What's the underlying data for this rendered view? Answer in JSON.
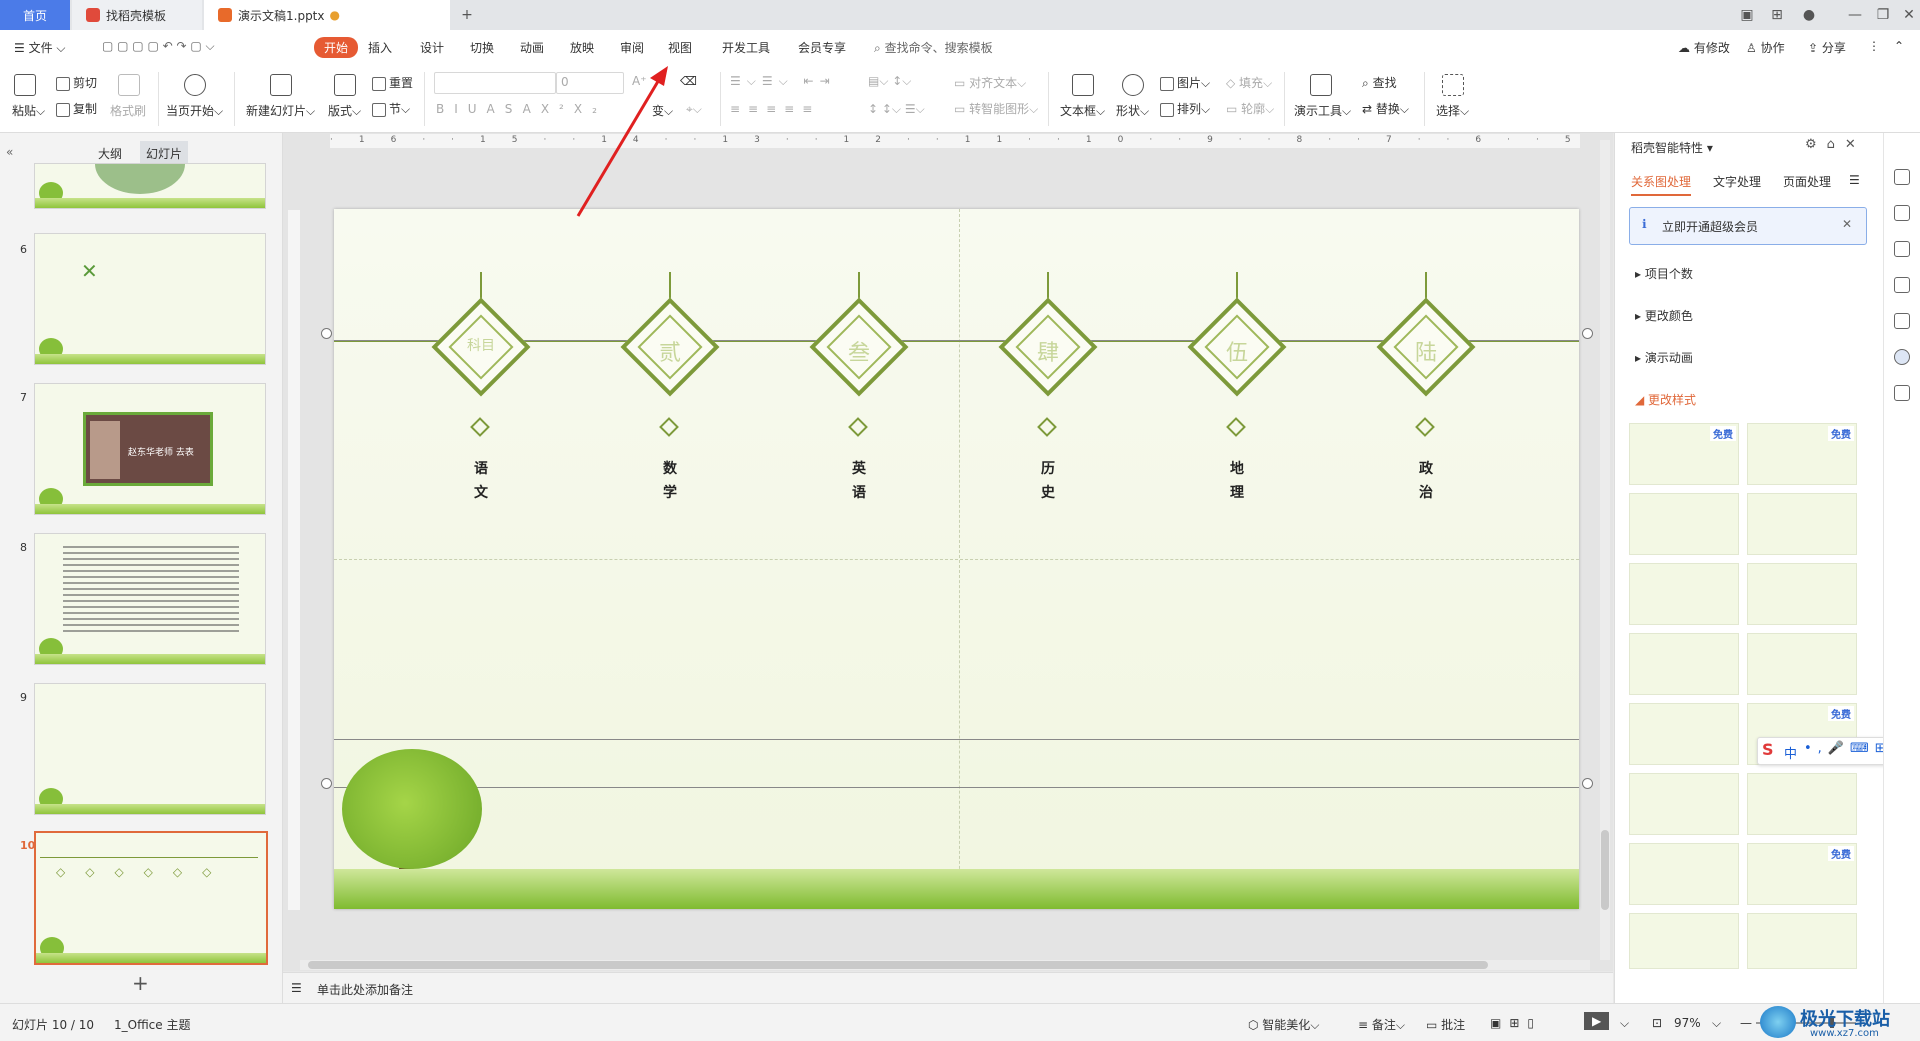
{
  "titlebar": {
    "tabs": [
      {
        "label": "首页"
      },
      {
        "label": "找稻壳模板"
      },
      {
        "label": "演示文稿1.pptx"
      }
    ],
    "new_tab_label": "+"
  },
  "menubar": {
    "file": "文件",
    "items": [
      "开始",
      "插入",
      "设计",
      "切换",
      "动画",
      "放映",
      "审阅",
      "视图",
      "开发工具",
      "会员专享"
    ],
    "search_placeholder": "查找命令、搜索模板",
    "right": {
      "revise": "有修改",
      "collab": "协作",
      "share": "分享"
    }
  },
  "ribbon": {
    "paste": "粘贴",
    "cut": "剪切",
    "copy": "复制",
    "format_painter": "格式刷",
    "from_first": "当页开始",
    "new_slide": "新建幻灯片",
    "layout": "版式",
    "reset": "重置",
    "section": "节",
    "font_size": "0",
    "align_text": "对齐文本",
    "convert_smartart": "转智能图形",
    "textbox": "文本框",
    "shape": "形状",
    "picture": "图片",
    "arrange": "排列",
    "fill": "填充",
    "outline": "轮廓",
    "present_tools": "演示工具",
    "find": "查找",
    "replace": "替换",
    "select": "选择"
  },
  "left_panel": {
    "tabs": {
      "outline": "大纲",
      "slides": "幻灯片"
    },
    "slide_numbers": [
      "6",
      "7",
      "8",
      "9",
      "10"
    ],
    "slide7_caption": "赵东华老师 去表",
    "add_label": "+"
  },
  "slide": {
    "ornaments": [
      {
        "num": "科目",
        "subject": [
          "语",
          "文"
        ]
      },
      {
        "num": "贰",
        "subject": [
          "数",
          "学"
        ]
      },
      {
        "num": "叁",
        "subject": [
          "英",
          "语"
        ]
      },
      {
        "num": "肆",
        "subject": [
          "历",
          "史"
        ]
      },
      {
        "num": "伍",
        "subject": [
          "地",
          "理"
        ]
      },
      {
        "num": "陆",
        "subject": [
          "政",
          "治"
        ]
      }
    ]
  },
  "notes": {
    "placeholder": "单击此处添加备注"
  },
  "right_panel": {
    "title": "稻壳智能特性",
    "tabs": [
      "关系图处理",
      "文字处理",
      "页面处理"
    ],
    "banner": "立即开通超级会员",
    "sections": [
      "项目个数",
      "更改颜色",
      "演示动画",
      "更改样式"
    ],
    "free_label": "免费",
    "ime": "中"
  },
  "statusbar": {
    "slide_info": "幻灯片 10 / 10",
    "theme": "1_Office 主题",
    "beautify": "智能美化",
    "notes": "备注",
    "comments": "批注",
    "zoom": "97%"
  },
  "watermark": {
    "site": "极光下载站",
    "url": "www.xz7.com"
  },
  "colors": {
    "accent": "#e65a33",
    "tab_home": "#4b7be8",
    "ornament": "#7d9a3a",
    "selection": "#e0683a"
  }
}
